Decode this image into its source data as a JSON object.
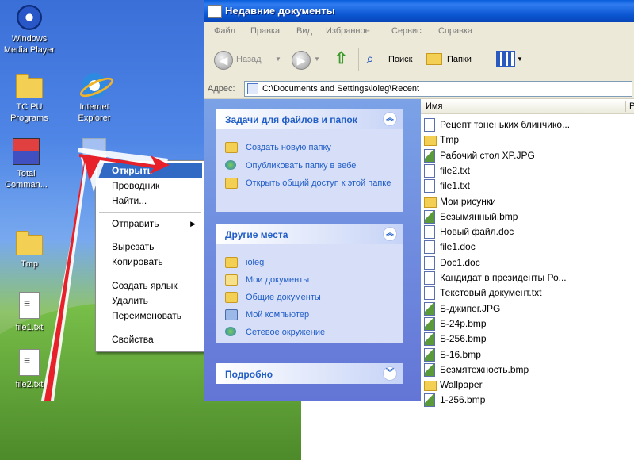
{
  "desktop": {
    "icons": [
      {
        "label": "Windows Media Player",
        "icon": "media-player-icon"
      },
      {
        "label": "TC PU Programs",
        "icon": "folder-icon"
      },
      {
        "label": "Internet Explorer",
        "icon": "internet-explorer-icon"
      },
      {
        "label": "Total Comman...",
        "icon": "total-commander-icon"
      },
      {
        "label": "Tmp",
        "icon": "folder-icon"
      },
      {
        "label": "file1.txt",
        "icon": "text-file-icon"
      },
      {
        "label": "file2.txt",
        "icon": "text-file-icon"
      }
    ]
  },
  "context_menu": {
    "items": [
      {
        "label": "Открыть",
        "selected": true
      },
      {
        "label": "Проводник"
      },
      {
        "label": "Найти..."
      },
      {
        "label": "Отправить",
        "submenu": true
      },
      {
        "label": "Вырезать"
      },
      {
        "label": "Копировать"
      },
      {
        "label": "Создать ярлык"
      },
      {
        "label": "Удалить"
      },
      {
        "label": "Переименовать"
      },
      {
        "label": "Свойства"
      }
    ]
  },
  "window": {
    "title": "Недавние документы",
    "menu": [
      "Файл",
      "Правка",
      "Вид",
      "Избранное",
      "Сервис",
      "Справка"
    ],
    "toolbar": {
      "back": "Назад",
      "search": "Поиск",
      "folders": "Папки"
    },
    "address": {
      "label": "Адрес:",
      "value": "C:\\Documents and Settings\\ioleg\\Recent"
    },
    "tasks_pane": {
      "title": "Задачи для файлов и папок",
      "items": [
        "Создать новую папку",
        "Опубликовать папку в вебе",
        "Открыть общий доступ к этой папке"
      ]
    },
    "places_pane": {
      "title": "Другие места",
      "items": [
        "ioleg",
        "Мои документы",
        "Общие документы",
        "Мой компьютер",
        "Сетевое окружение"
      ]
    },
    "details_pane": {
      "title": "Подробно"
    },
    "file_list": {
      "column_name": "Имя",
      "column_right": "Р",
      "files": [
        {
          "name": "Рецепт тоненьких блинчико...",
          "type": "doc"
        },
        {
          "name": "Tmp",
          "type": "folder"
        },
        {
          "name": "Рабочий стол XP.JPG",
          "type": "image"
        },
        {
          "name": "file2.txt",
          "type": "doc"
        },
        {
          "name": "file1.txt",
          "type": "doc"
        },
        {
          "name": "Мои рисунки",
          "type": "folder"
        },
        {
          "name": "Безымянный.bmp",
          "type": "image"
        },
        {
          "name": "Новый файл.doc",
          "type": "doc"
        },
        {
          "name": "file1.doc",
          "type": "doc"
        },
        {
          "name": "Doc1.doc",
          "type": "doc"
        },
        {
          "name": "Кандидат в президенты Ро...",
          "type": "doc"
        },
        {
          "name": "Текстовый документ.txt",
          "type": "doc"
        },
        {
          "name": "Б-джипег.JPG",
          "type": "image"
        },
        {
          "name": "Б-24р.bmp",
          "type": "image"
        },
        {
          "name": "Б-256.bmp",
          "type": "image"
        },
        {
          "name": "Б-16.bmp",
          "type": "image"
        },
        {
          "name": "Безмятежность.bmp",
          "type": "image"
        },
        {
          "name": "Wallpaper",
          "type": "folder"
        },
        {
          "name": "1-256.bmp",
          "type": "image"
        }
      ]
    }
  },
  "colors": {
    "title_bar": "#0a5ddb",
    "selection": "#316ac5",
    "link": "#215dc6",
    "annotation_arrow": "#e8202a"
  }
}
